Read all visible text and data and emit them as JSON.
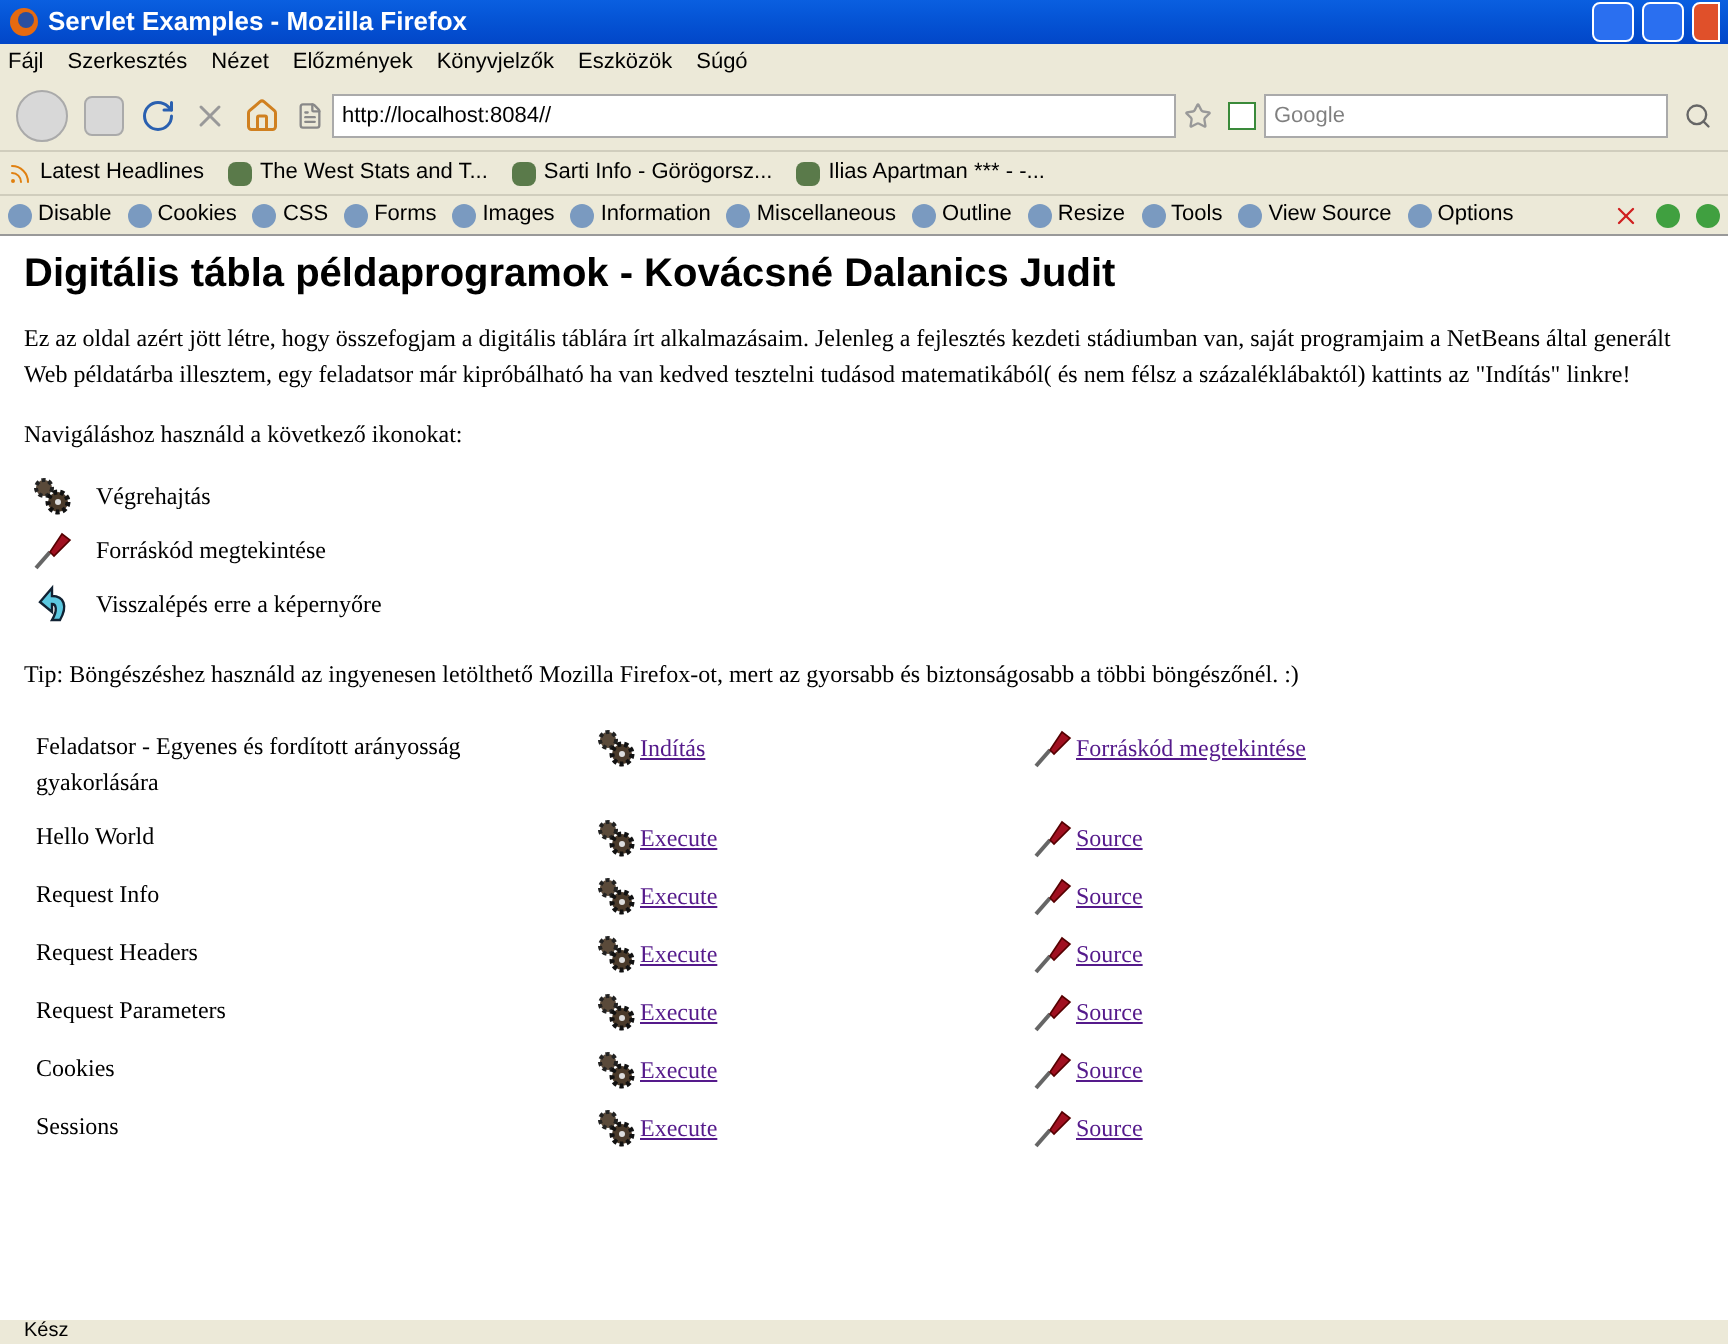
{
  "window": {
    "title": "Servlet Examples - Mozilla Firefox"
  },
  "menu": [
    "Fájl",
    "Szerkesztés",
    "Nézet",
    "Előzmények",
    "Könyvjelzők",
    "Eszközök",
    "Súgó"
  ],
  "address": {
    "value": "http://localhost:8084//"
  },
  "search": {
    "placeholder": "Google"
  },
  "bookmarks": [
    "Latest Headlines",
    "The West Stats and T...",
    "Sarti Info - Görögorsz...",
    "Ilias Apartman *** - -..."
  ],
  "devtools": [
    "Disable",
    "Cookies",
    "CSS",
    "Forms",
    "Images",
    "Information",
    "Miscellaneous",
    "Outline",
    "Resize",
    "Tools",
    "View Source",
    "Options"
  ],
  "page": {
    "heading": "Digitális tábla példaprogramok - Kovácsné Dalanics Judit",
    "intro": "Ez az oldal azért jött létre, hogy összefogjam a digitális táblára írt alkalmazásaim. Jelenleg a fejlesztés kezdeti stádiumban van, saját programjaim a NetBeans által generált Web példatárba illesztem, egy feladatsor már kipróbálható ha van kedved tesztelni tudásod matematikából( és nem félsz a százaléklábaktól) kattints az \"Indítás\" linkre!",
    "nav_intro": "Navigáláshoz használd a következő ikonokat:",
    "legend": [
      {
        "kind": "gears",
        "label": "Végrehajtás"
      },
      {
        "kind": "screwdriver",
        "label": "Forráskód megtekintése"
      },
      {
        "kind": "back",
        "label": "Visszalépés erre a képernyőre"
      }
    ],
    "tip": "Tip: Böngészéshez használd az ingyenesen letölthető Mozilla Firefox-ot, mert az gyorsabb és biztonságosabb a többi böngészőnél. :)",
    "examples": [
      {
        "name": "Feladatsor - Egyenes és fordított arányosság gyakorlására",
        "execute": "Indítás",
        "source": "Forráskód megtekintése"
      },
      {
        "name": "Hello World",
        "execute": "Execute",
        "source": "Source"
      },
      {
        "name": "Request Info",
        "execute": "Execute",
        "source": "Source"
      },
      {
        "name": "Request Headers",
        "execute": "Execute",
        "source": "Source"
      },
      {
        "name": "Request Parameters",
        "execute": "Execute",
        "source": "Source"
      },
      {
        "name": "Cookies",
        "execute": "Execute",
        "source": "Source"
      },
      {
        "name": "Sessions",
        "execute": "Execute",
        "source": "Source"
      }
    ]
  },
  "status_bar": "Kész"
}
